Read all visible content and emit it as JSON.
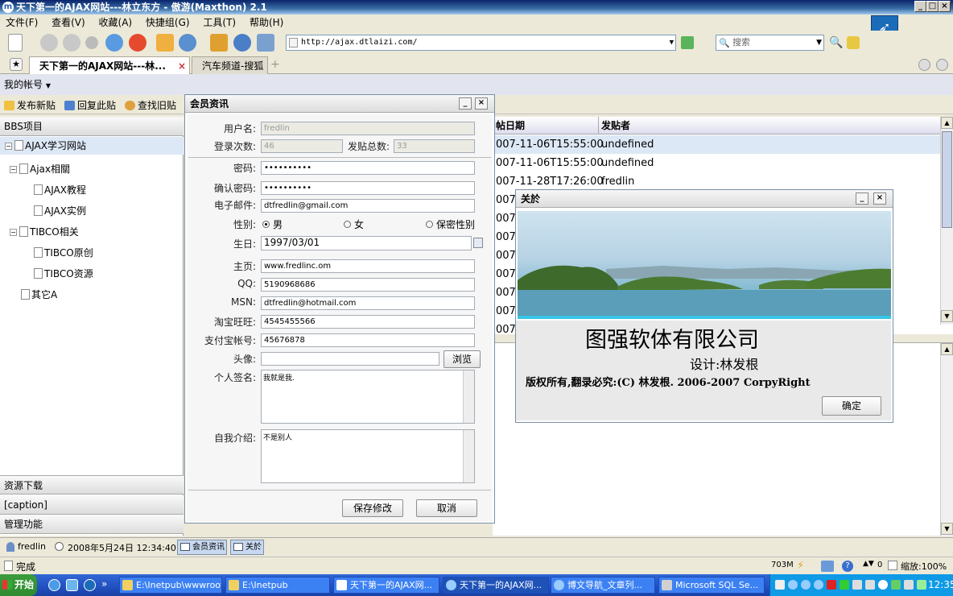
{
  "window": {
    "title": "天下第一的AJAX网站---林立东方 - 傲游(Maxthon) 2.1"
  },
  "menu": [
    "文件(F)",
    "查看(V)",
    "收藏(A)",
    "快捷组(G)",
    "工具(T)",
    "帮助(H)"
  ],
  "address": {
    "url": "http://ajax.dtlaizi.com/"
  },
  "search": {
    "placeholder": "搜索"
  },
  "tabs": [
    {
      "label": "天下第一的AJAX网站---林..."
    },
    {
      "label": "汽车频道-搜狐"
    }
  ],
  "account": {
    "label": "我的帐号"
  },
  "actions": [
    "发布新贴",
    "回复此贴",
    "查找旧贴"
  ],
  "left_panel": {
    "header": "BBS项目",
    "tree": [
      {
        "label": "AJAX学习网站"
      },
      {
        "label": "Ajax相關"
      },
      {
        "label": "AJAX教程"
      },
      {
        "label": "AJAX实例"
      },
      {
        "label": "TIBCO相关"
      },
      {
        "label": "TIBCO原创"
      },
      {
        "label": "TIBCO资源"
      },
      {
        "label": "其它A"
      }
    ],
    "bottom_sections": [
      "资源下载",
      "[caption]",
      "管理功能"
    ]
  },
  "grid": {
    "headers": [
      "帖日期",
      "发贴者"
    ],
    "rows": [
      {
        "date": "007-11-06T15:55:00",
        "author": "undefined"
      },
      {
        "date": "007-11-06T15:55:00",
        "author": "undefined"
      },
      {
        "date": "007-11-28T17:26:00",
        "author": "fredlin"
      },
      {
        "date": "007-",
        "author": ""
      },
      {
        "date": "007-",
        "author": ""
      },
      {
        "date": "007-",
        "author": ""
      },
      {
        "date": "007-",
        "author": ""
      },
      {
        "date": "007-",
        "author": ""
      },
      {
        "date": "007-",
        "author": ""
      },
      {
        "date": "007-",
        "author": ""
      },
      {
        "date": "007-",
        "author": ""
      }
    ]
  },
  "member_dialog": {
    "title": "会员资讯",
    "username_label": "用户名:",
    "username": "fredlin",
    "logins_label": "登录次数:",
    "logins": "46",
    "posts_label": "发贴总数:",
    "posts": "33",
    "password_label": "密码:",
    "password": "••••••••••",
    "confirm_label": "确认密码:",
    "confirm": "••••••••••",
    "email_label": "电子邮件:",
    "email": "dtfredlin@gmail.com",
    "gender_label": "性别:",
    "gender_male": "男",
    "gender_female": "女",
    "gender_secret": "保密性别",
    "birthday_label": "生日:",
    "birthday": "1997/03/01",
    "homepage_label": "主页:",
    "homepage": "www.fredlinc.om",
    "qq_label": "QQ:",
    "qq": "5190968686",
    "msn_label": "MSN:",
    "msn": "dtfredlin@hotmail.com",
    "taobao_label": "淘宝旺旺:",
    "taobao": "4545455566",
    "alipay_label": "支付宝帐号:",
    "alipay": "45676878",
    "avatar_label": "头像:",
    "browse": "浏览",
    "signature_label": "个人签名:",
    "signature": "我就是我.",
    "intro_label": "自我介绍:",
    "intro": "不是别人",
    "save": "保存修改",
    "cancel": "取消"
  },
  "about_dialog": {
    "title": "关於",
    "company": "图强软体有限公司",
    "designer": "设计:林发根",
    "copyright": "版权所有,翻录必究:(C) 林发根. 2006-2007 CorpyRight",
    "ok": "确定"
  },
  "status_tabs": {
    "user": "fredlin",
    "datetime": "2008年5月24日 12:34:40",
    "win1": "会员资讯",
    "win2": "关於"
  },
  "browser_status": {
    "text": "完成",
    "memory": "703M",
    "popups": "0",
    "zoom": "缩放:100%"
  },
  "taskbar": {
    "start": "开始",
    "tasks": [
      "E:\\Inetpub\\wwwroot",
      "E:\\Inetpub",
      "天下第一的AJAX网...",
      "天下第一的AJAX网...",
      "博文导航_文章列...",
      "Microsoft SQL Se..."
    ],
    "clock": "12:35"
  }
}
